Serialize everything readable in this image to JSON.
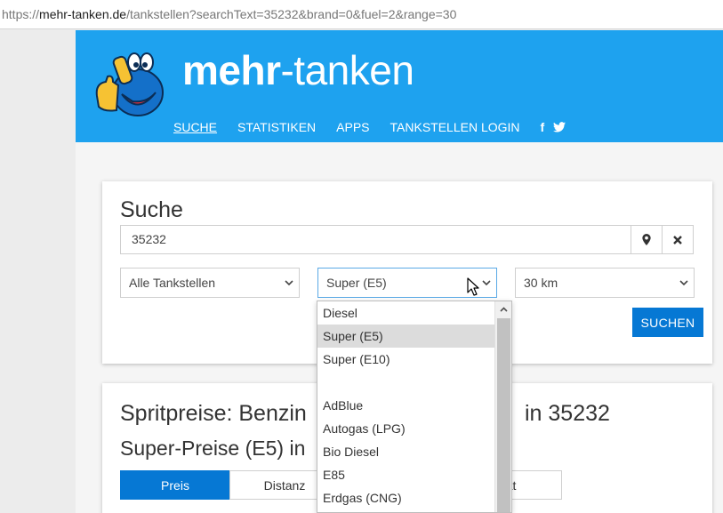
{
  "browser": {
    "url_prefix": "https://",
    "url_host": "mehr-tanken.de",
    "url_path": "/tankstellen?searchText=35232&brand=0&fuel=2&range=30"
  },
  "header": {
    "brand_bold": "mehr",
    "brand_rest": "-tanken",
    "nav": [
      "SUCHE",
      "STATISTIKEN",
      "APPS",
      "TANKSTELLEN LOGIN"
    ],
    "social": [
      "f",
      "twitter-icon"
    ],
    "colors": {
      "header_bg": "#1ea2ef",
      "accent": "#0678d4"
    }
  },
  "search": {
    "title": "Suche",
    "postal_code": "35232",
    "brand_select": "Alle Tankstellen",
    "fuel_select": "Super (E5)",
    "range_select": "30 km",
    "submit_label": "SUCHEN"
  },
  "fuel_dropdown": {
    "options": [
      "Diesel",
      "Super (E5)",
      "Super (E10)",
      "",
      "AdBlue",
      "Autogas (LPG)",
      "Bio Diesel",
      "E85",
      "Erdgas (CNG)"
    ],
    "selected_index": 1
  },
  "results": {
    "title_left": "Spritpreise: Benzin",
    "title_right": "in 35232",
    "subtitle": "Super-Preise (E5) in",
    "tabs": [
      "Preis",
      "Distanz",
      "lität"
    ],
    "active_tab": 0
  }
}
